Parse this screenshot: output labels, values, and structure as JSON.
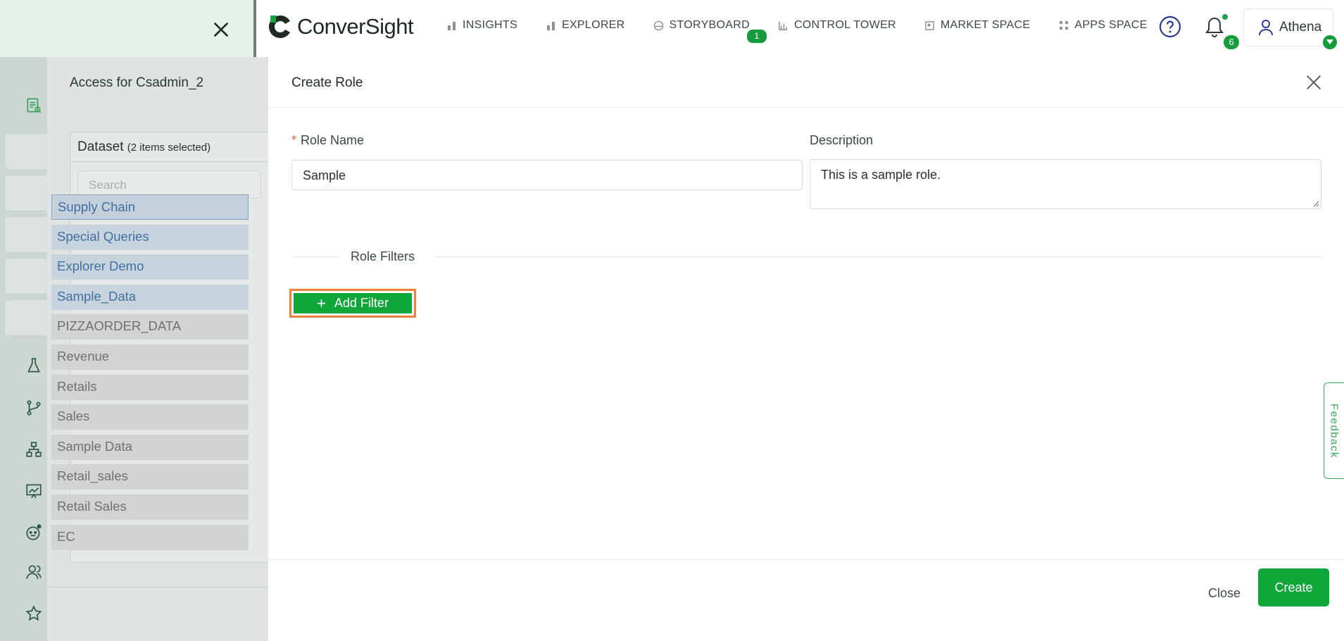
{
  "nav": {
    "logo_text": "ConverSight",
    "items": [
      {
        "label": "INSIGHTS",
        "icon": "bar-chart-icon"
      },
      {
        "label": "EXPLORER",
        "icon": "bar-chart-icon"
      },
      {
        "label": "STORYBOARD",
        "icon": "palette-icon",
        "badge": "1"
      },
      {
        "label": "CONTROL TOWER",
        "icon": "tower-icon"
      },
      {
        "label": "MARKET SPACE",
        "icon": "store-icon"
      },
      {
        "label": "APPS SPACE",
        "icon": "apps-grid-icon"
      }
    ],
    "notifications_count": "6",
    "user_name": "Athena"
  },
  "access_panel": {
    "title": "Access for Csadmin_2",
    "dataset_label": "Dataset",
    "dataset_selected": "(2 items selected)",
    "search_placeholder": "Search",
    "datasets": [
      {
        "label": "Supply Chain",
        "selected": true
      },
      {
        "label": "Special Queries",
        "selected": true
      },
      {
        "label": "Explorer Demo",
        "selected": true
      },
      {
        "label": "Sample_Data",
        "selected": true
      },
      {
        "label": "PIZZAORDER_DATA",
        "selected": false
      },
      {
        "label": "Revenue",
        "selected": false
      },
      {
        "label": "Retails",
        "selected": false
      },
      {
        "label": "Sales",
        "selected": false
      },
      {
        "label": "Sample Data",
        "selected": false
      },
      {
        "label": "Retail_sales",
        "selected": false
      },
      {
        "label": "Retail Sales",
        "selected": false
      },
      {
        "label": "EC",
        "selected": false
      }
    ]
  },
  "drawer": {
    "title": "Create Role",
    "role_name_label": "Role Name",
    "role_name_value": "Sample",
    "description_label": "Description",
    "description_value": "This is a sample role.",
    "filters_title": "Role Filters",
    "add_filter_label": "Add Filter",
    "close_label": "Close",
    "create_label": "Create"
  },
  "feedback_label": "Feedback",
  "colors": {
    "brand_green": "#0fa63a",
    "highlight_orange": "#f08236"
  }
}
